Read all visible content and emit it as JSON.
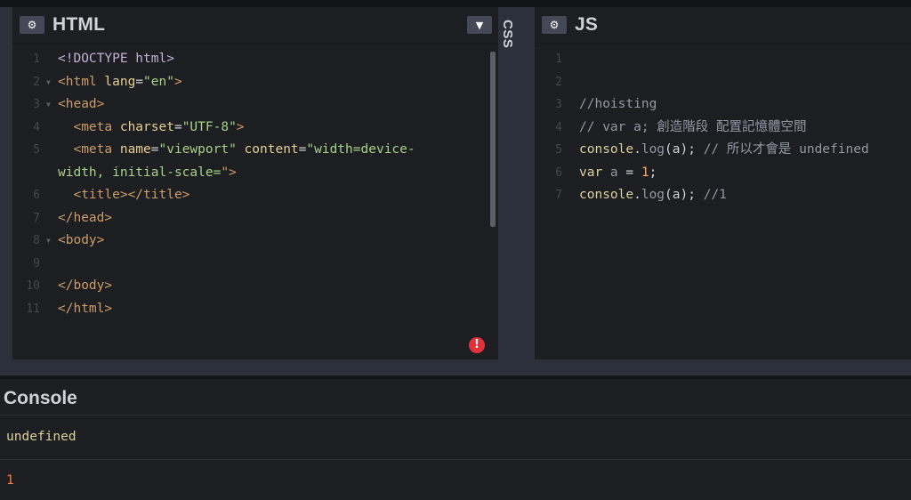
{
  "html_panel": {
    "title": "HTML",
    "lines": [
      {
        "n": "1",
        "parts": [
          {
            "t": "<!DOCTYPE html>",
            "c": "doctype"
          }
        ]
      },
      {
        "n": "2",
        "fold": true,
        "parts": [
          {
            "t": "<html ",
            "c": "tag"
          },
          {
            "t": "lang",
            "c": "attr"
          },
          {
            "t": "=",
            "c": "plain"
          },
          {
            "t": "\"en\"",
            "c": "str"
          },
          {
            "t": ">",
            "c": "tag"
          }
        ]
      },
      {
        "n": "3",
        "fold": true,
        "parts": [
          {
            "t": "<head>",
            "c": "tag"
          }
        ]
      },
      {
        "n": "4",
        "parts": [
          {
            "t": "  <meta ",
            "c": "tag"
          },
          {
            "t": "charset",
            "c": "attr"
          },
          {
            "t": "=",
            "c": "plain"
          },
          {
            "t": "\"UTF-8\"",
            "c": "str"
          },
          {
            "t": ">",
            "c": "tag"
          }
        ]
      },
      {
        "n": "5",
        "parts": [
          {
            "t": "  <meta ",
            "c": "tag"
          },
          {
            "t": "name",
            "c": "attr"
          },
          {
            "t": "=",
            "c": "plain"
          },
          {
            "t": "\"viewport\"",
            "c": "str"
          },
          {
            "t": " content",
            "c": "attr"
          },
          {
            "t": "=",
            "c": "plain"
          },
          {
            "t": "\"width=device-",
            "c": "str"
          }
        ]
      },
      {
        "n": "",
        "parts": [
          {
            "t": "width, initial-scale=",
            "c": "str"
          },
          {
            "t": "\">",
            "c": "tag"
          }
        ]
      },
      {
        "n": "6",
        "parts": [
          {
            "t": "  <title></title>",
            "c": "tag"
          }
        ]
      },
      {
        "n": "7",
        "parts": [
          {
            "t": "</head>",
            "c": "tag"
          }
        ]
      },
      {
        "n": "8",
        "fold": true,
        "parts": [
          {
            "t": "<body>",
            "c": "tag"
          }
        ]
      },
      {
        "n": "9",
        "parts": []
      },
      {
        "n": "10",
        "parts": [
          {
            "t": "</body>",
            "c": "tag"
          }
        ]
      },
      {
        "n": "11",
        "parts": [
          {
            "t": "</html>",
            "c": "tag"
          }
        ]
      }
    ]
  },
  "css_panel": {
    "label": "CSS"
  },
  "js_panel": {
    "title": "JS",
    "lines": [
      {
        "n": "1",
        "parts": []
      },
      {
        "n": "2",
        "parts": []
      },
      {
        "n": "3",
        "parts": [
          {
            "t": "//hoisting",
            "c": "com"
          }
        ]
      },
      {
        "n": "4",
        "parts": [
          {
            "t": "// var a; 創造階段 配置記憶體空間",
            "c": "com"
          }
        ]
      },
      {
        "n": "5",
        "parts": [
          {
            "t": "console",
            "c": "fn"
          },
          {
            "t": ".",
            "c": "plain"
          },
          {
            "t": "log",
            "c": "com"
          },
          {
            "t": "(a); ",
            "c": "plain"
          },
          {
            "t": "// 所以才會是 undefined",
            "c": "com"
          }
        ]
      },
      {
        "n": "6",
        "parts": [
          {
            "t": "var",
            "c": "kw"
          },
          {
            "t": " a ",
            "c": "com"
          },
          {
            "t": "= ",
            "c": "plain"
          },
          {
            "t": "1",
            "c": "num"
          },
          {
            "t": ";",
            "c": "plain"
          }
        ]
      },
      {
        "n": "7",
        "parts": [
          {
            "t": "console",
            "c": "fn"
          },
          {
            "t": ".",
            "c": "plain"
          },
          {
            "t": "log",
            "c": "com"
          },
          {
            "t": "(a); ",
            "c": "plain"
          },
          {
            "t": "//1",
            "c": "com"
          }
        ]
      }
    ]
  },
  "console": {
    "title": "Console",
    "output": [
      "undefined",
      "1"
    ]
  },
  "icons": {
    "settings": "gear-icon",
    "dropdown": "chevron-down-icon",
    "error": "error-icon",
    "error_glyph": "!"
  },
  "colors": {
    "bg": "#1d1e22",
    "chrome": "#2c303a",
    "error": "#e2303c",
    "console_number": "#ff7b3c",
    "console_undefined": "#dcd09a"
  }
}
